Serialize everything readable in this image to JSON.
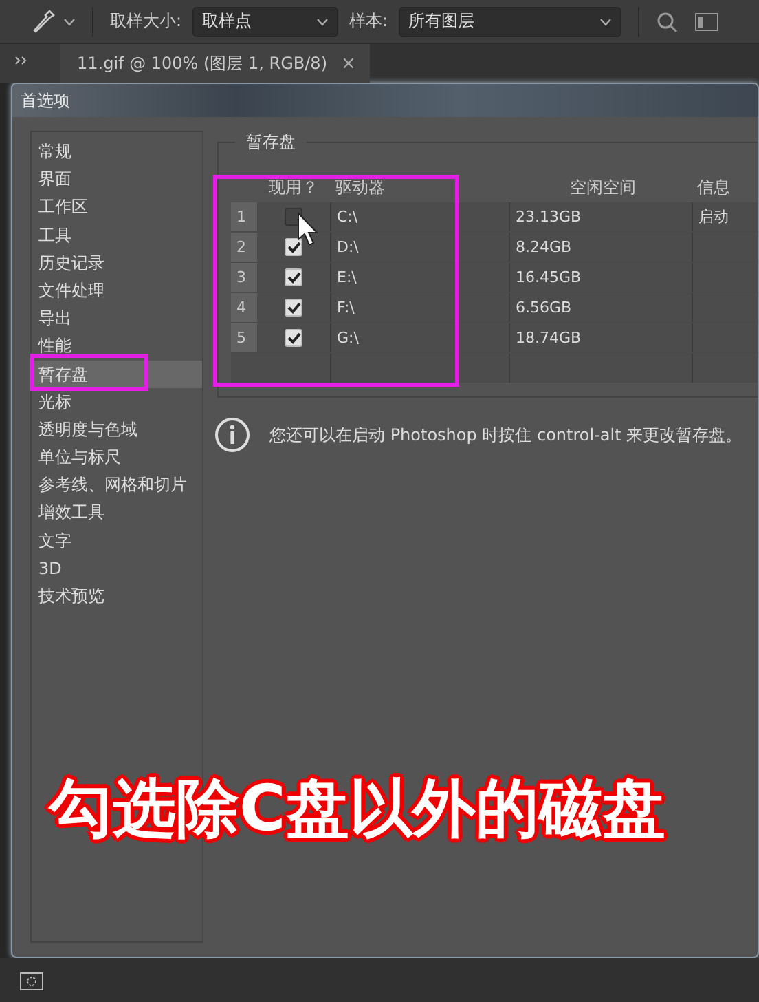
{
  "options_bar": {
    "sample_size_label": "取样大小:",
    "sample_size_value": "取样点",
    "sample_label": "样本:",
    "sample_value": "所有图层"
  },
  "document_tab": {
    "title": "11.gif @ 100% (图层 1, RGB/8)",
    "close": "×"
  },
  "dialog": {
    "title": "首选项"
  },
  "sidebar": {
    "items": [
      {
        "label": "常规",
        "selected": false
      },
      {
        "label": "界面",
        "selected": false
      },
      {
        "label": "工作区",
        "selected": false
      },
      {
        "label": "工具",
        "selected": false
      },
      {
        "label": "历史记录",
        "selected": false
      },
      {
        "label": "文件处理",
        "selected": false
      },
      {
        "label": "导出",
        "selected": false
      },
      {
        "label": "性能",
        "selected": false
      },
      {
        "label": "暂存盘",
        "selected": true
      },
      {
        "label": "光标",
        "selected": false
      },
      {
        "label": "透明度与色域",
        "selected": false
      },
      {
        "label": "单位与标尺",
        "selected": false
      },
      {
        "label": "参考线、网格和切片",
        "selected": false
      },
      {
        "label": "增效工具",
        "selected": false
      },
      {
        "label": "文字",
        "selected": false
      },
      {
        "label": "3D",
        "selected": false
      },
      {
        "label": "技术预览",
        "selected": false
      }
    ]
  },
  "scratch_disks": {
    "group_title": "暂存盘",
    "columns": [
      "现用？",
      "驱动器",
      "空闲空间",
      "信息"
    ],
    "rows": [
      {
        "index": "1",
        "checked": false,
        "drive": "C:\\",
        "free_space": "23.13GB",
        "info": "启动"
      },
      {
        "index": "2",
        "checked": true,
        "drive": "D:\\",
        "free_space": "8.24GB"
      },
      {
        "index": "3",
        "checked": true,
        "drive": "E:\\",
        "free_space": "16.45GB"
      },
      {
        "index": "4",
        "checked": true,
        "drive": "F:\\",
        "free_space": "6.56GB"
      },
      {
        "index": "5",
        "checked": true,
        "drive": "G:\\",
        "free_space": "18.74GB"
      }
    ],
    "note": "您还可以在启动 Photoshop 时按住 control-alt 来更改暂存盘。"
  },
  "caption": "勾选除C盘以外的磁盘"
}
